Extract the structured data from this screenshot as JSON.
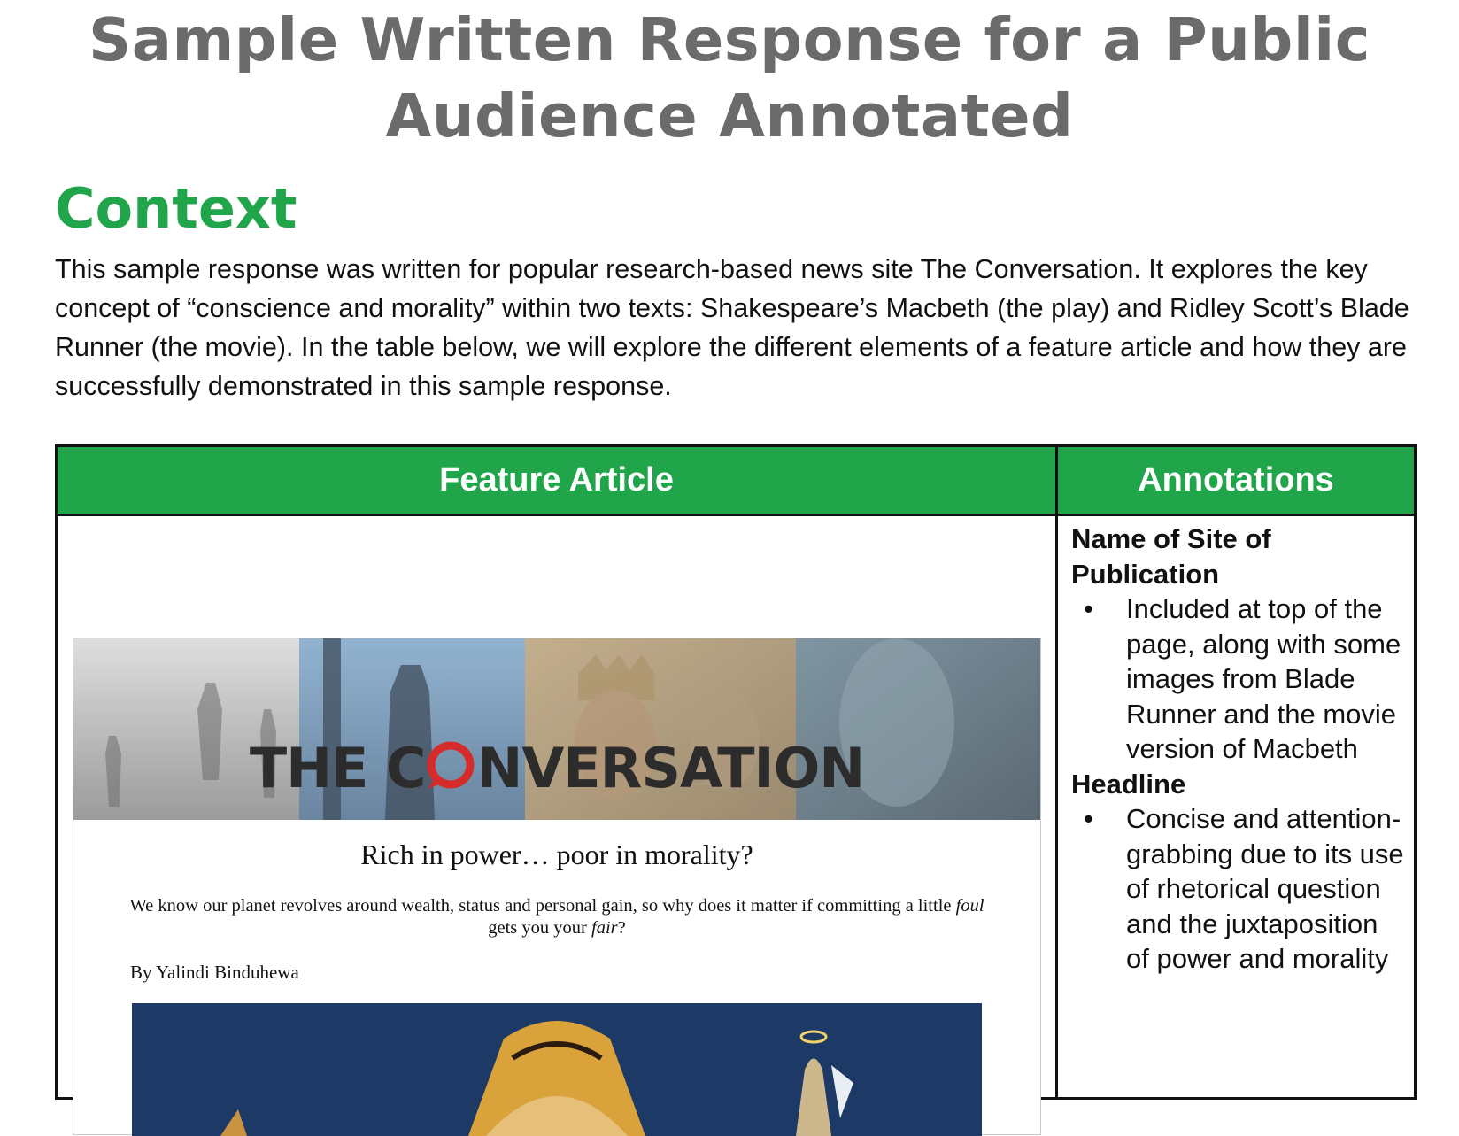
{
  "title": "Sample Written Response for a Public Audience Annotated",
  "title_line1": "Sample Written Response for a Public",
  "title_line2": "Audience Annotated",
  "context": {
    "heading": "Context",
    "paragraph": "This sample response was written for popular research-based news site The Conversation. It explores the key concept of “conscience and morality” within two texts: Shakespeare’s Macbeth (the play) and Ridley Scott’s Blade Runner (the movie). In the table below, we will explore the different elements of a feature article and how they are successfully demonstrated in this sample response."
  },
  "table": {
    "col1_header": "Feature Article",
    "col2_header": "Annotations"
  },
  "article": {
    "logo": {
      "before": "THE C",
      "after": "NVERSATION"
    },
    "headline": "Rich in power… poor in morality?",
    "standfirst": {
      "part1": "We know our planet revolves around wealth, status and personal gain, so why does it matter if committing a little ",
      "foul": "foul",
      "part2": " gets you your ",
      "fair": "fair",
      "part3": "?"
    },
    "byline": "By Yalindi Binduhewa"
  },
  "annotations": [
    {
      "heading": "Name of Site of Publication",
      "bullets": [
        "Included at top of the page, along with some images from Blade Runner and the movie version of Macbeth"
      ]
    },
    {
      "heading": "Headline",
      "bullets": [
        "Concise and attention-grabbing due to its use of rhetorical question and the juxtaposition of power and morality"
      ]
    }
  ],
  "icons": {
    "bullet": "•",
    "logo_o": "speech-bubble-o-icon"
  },
  "colors": {
    "accent_green": "#21a54a",
    "title_gray": "#6b6b6b",
    "logo_red": "#d62b2b"
  }
}
